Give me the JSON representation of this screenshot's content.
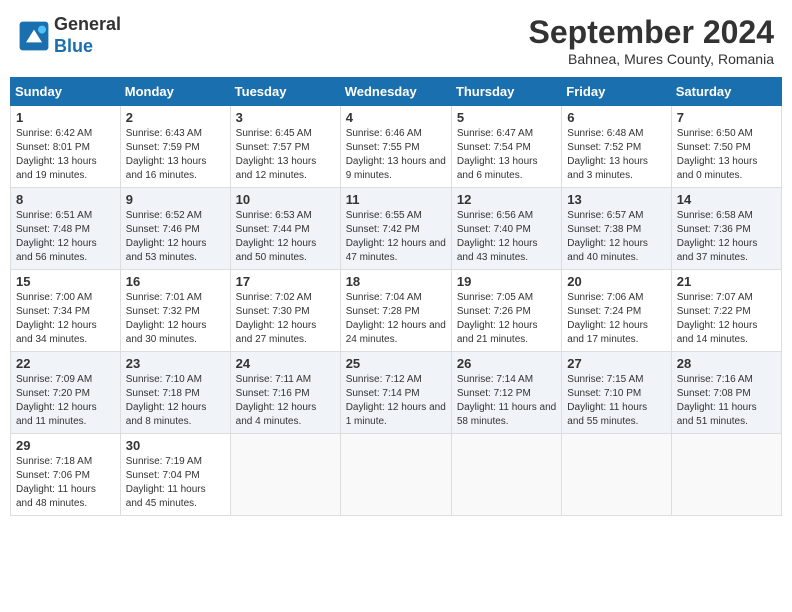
{
  "header": {
    "logo_general": "General",
    "logo_blue": "Blue",
    "month_title": "September 2024",
    "subtitle": "Bahnea, Mures County, Romania"
  },
  "weekdays": [
    "Sunday",
    "Monday",
    "Tuesday",
    "Wednesday",
    "Thursday",
    "Friday",
    "Saturday"
  ],
  "weeks": [
    [
      {
        "day": "1",
        "sunrise": "6:42 AM",
        "sunset": "8:01 PM",
        "daylight": "13 hours and 19 minutes."
      },
      {
        "day": "2",
        "sunrise": "6:43 AM",
        "sunset": "7:59 PM",
        "daylight": "13 hours and 16 minutes."
      },
      {
        "day": "3",
        "sunrise": "6:45 AM",
        "sunset": "7:57 PM",
        "daylight": "13 hours and 12 minutes."
      },
      {
        "day": "4",
        "sunrise": "6:46 AM",
        "sunset": "7:55 PM",
        "daylight": "13 hours and 9 minutes."
      },
      {
        "day": "5",
        "sunrise": "6:47 AM",
        "sunset": "7:54 PM",
        "daylight": "13 hours and 6 minutes."
      },
      {
        "day": "6",
        "sunrise": "6:48 AM",
        "sunset": "7:52 PM",
        "daylight": "13 hours and 3 minutes."
      },
      {
        "day": "7",
        "sunrise": "6:50 AM",
        "sunset": "7:50 PM",
        "daylight": "13 hours and 0 minutes."
      }
    ],
    [
      {
        "day": "8",
        "sunrise": "6:51 AM",
        "sunset": "7:48 PM",
        "daylight": "12 hours and 56 minutes."
      },
      {
        "day": "9",
        "sunrise": "6:52 AM",
        "sunset": "7:46 PM",
        "daylight": "12 hours and 53 minutes."
      },
      {
        "day": "10",
        "sunrise": "6:53 AM",
        "sunset": "7:44 PM",
        "daylight": "12 hours and 50 minutes."
      },
      {
        "day": "11",
        "sunrise": "6:55 AM",
        "sunset": "7:42 PM",
        "daylight": "12 hours and 47 minutes."
      },
      {
        "day": "12",
        "sunrise": "6:56 AM",
        "sunset": "7:40 PM",
        "daylight": "12 hours and 43 minutes."
      },
      {
        "day": "13",
        "sunrise": "6:57 AM",
        "sunset": "7:38 PM",
        "daylight": "12 hours and 40 minutes."
      },
      {
        "day": "14",
        "sunrise": "6:58 AM",
        "sunset": "7:36 PM",
        "daylight": "12 hours and 37 minutes."
      }
    ],
    [
      {
        "day": "15",
        "sunrise": "7:00 AM",
        "sunset": "7:34 PM",
        "daylight": "12 hours and 34 minutes."
      },
      {
        "day": "16",
        "sunrise": "7:01 AM",
        "sunset": "7:32 PM",
        "daylight": "12 hours and 30 minutes."
      },
      {
        "day": "17",
        "sunrise": "7:02 AM",
        "sunset": "7:30 PM",
        "daylight": "12 hours and 27 minutes."
      },
      {
        "day": "18",
        "sunrise": "7:04 AM",
        "sunset": "7:28 PM",
        "daylight": "12 hours and 24 minutes."
      },
      {
        "day": "19",
        "sunrise": "7:05 AM",
        "sunset": "7:26 PM",
        "daylight": "12 hours and 21 minutes."
      },
      {
        "day": "20",
        "sunrise": "7:06 AM",
        "sunset": "7:24 PM",
        "daylight": "12 hours and 17 minutes."
      },
      {
        "day": "21",
        "sunrise": "7:07 AM",
        "sunset": "7:22 PM",
        "daylight": "12 hours and 14 minutes."
      }
    ],
    [
      {
        "day": "22",
        "sunrise": "7:09 AM",
        "sunset": "7:20 PM",
        "daylight": "12 hours and 11 minutes."
      },
      {
        "day": "23",
        "sunrise": "7:10 AM",
        "sunset": "7:18 PM",
        "daylight": "12 hours and 8 minutes."
      },
      {
        "day": "24",
        "sunrise": "7:11 AM",
        "sunset": "7:16 PM",
        "daylight": "12 hours and 4 minutes."
      },
      {
        "day": "25",
        "sunrise": "7:12 AM",
        "sunset": "7:14 PM",
        "daylight": "12 hours and 1 minute."
      },
      {
        "day": "26",
        "sunrise": "7:14 AM",
        "sunset": "7:12 PM",
        "daylight": "11 hours and 58 minutes."
      },
      {
        "day": "27",
        "sunrise": "7:15 AM",
        "sunset": "7:10 PM",
        "daylight": "11 hours and 55 minutes."
      },
      {
        "day": "28",
        "sunrise": "7:16 AM",
        "sunset": "7:08 PM",
        "daylight": "11 hours and 51 minutes."
      }
    ],
    [
      {
        "day": "29",
        "sunrise": "7:18 AM",
        "sunset": "7:06 PM",
        "daylight": "11 hours and 48 minutes."
      },
      {
        "day": "30",
        "sunrise": "7:19 AM",
        "sunset": "7:04 PM",
        "daylight": "11 hours and 45 minutes."
      },
      null,
      null,
      null,
      null,
      null
    ]
  ]
}
